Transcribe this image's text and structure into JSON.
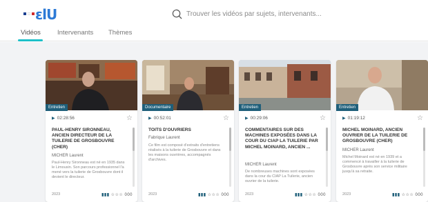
{
  "header": {
    "search_placeholder": "Trouver les vidéos par sujets, intervenants...",
    "flag_colors": [
      "#1a3e8f",
      "#ffffff",
      "#d02b2b"
    ],
    "logo_text": "ɛlU"
  },
  "tabs": [
    {
      "label": "Vidéos",
      "active": true
    },
    {
      "label": "Intervenants",
      "active": false
    },
    {
      "label": "Thèmes",
      "active": false
    }
  ],
  "cards": [
    {
      "badge": "Entretien",
      "duration": "02:28:56",
      "title": "PAUL-HENRY SIRONNEAU, ANCIEN DIRECTEUR DE LA TUILERIE DE GROSBOUVRE (CHER)",
      "author": "MICHER Laurent",
      "description": "Paul-Henry Sironneau est né en 1935 dans le Limousin. Son parcours professionnel l'a mené vers la tuilerie de Grosbouvre dont il devient le directeur.",
      "date": "2023",
      "stats": "000"
    },
    {
      "badge": "Documentaire",
      "duration": "00:52:01",
      "title": "TOITS D'OUVRIERS",
      "author": "Fabrique Laurent",
      "description": "Ce film est composé d'extraits d'entretiens réalisés à la tuilerie de Grosbouvre et dans les maisons ouvrières, accompagnés d'archives.",
      "date": "2023",
      "stats": "000"
    },
    {
      "badge": "Entretien",
      "duration": "00:29:06",
      "title": "COMMENTAIRES SUR DES MACHINES EXPOSÉES DANS LA COUR DU CIAP LA TUILERIE PAR MICHEL MOINARD, ANCIEN ...",
      "author": "MICHER Laurent",
      "description": "De nombreuses machines sont exposées dans la cour du CIAP La Tuilerie, ancien ouvrier de la tuilerie.",
      "date": "2023",
      "stats": "000"
    },
    {
      "badge": "Entretien",
      "duration": "01:19:12",
      "title": "MICHEL MOINARD, ANCIEN OUVRIER DE LA TUILERIE DE GROSBOUVRE (CHER)",
      "author": "MICHER Laurent",
      "description": "Michel Moinard est né en 1939 et a commencé à travailler à la tuilerie de Grosbouvre après son service militaire jusqu'à sa retraite.",
      "date": "2023",
      "stats": "000"
    }
  ]
}
